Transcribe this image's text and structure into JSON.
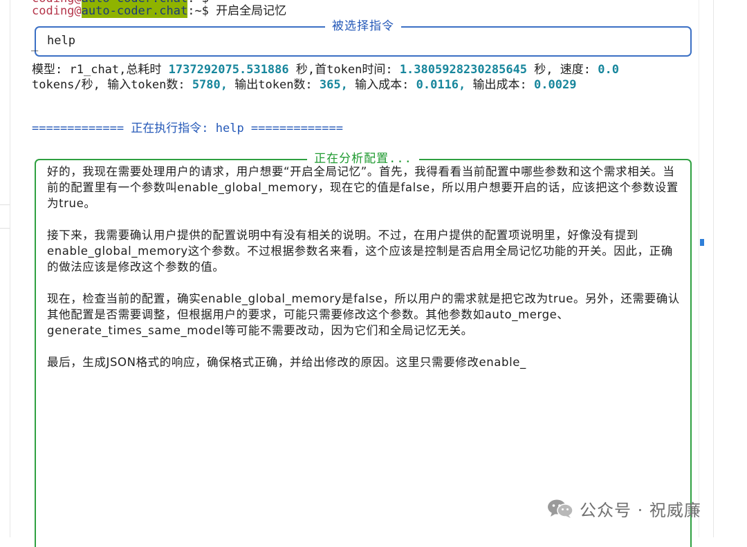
{
  "prompt": {
    "user": "coding",
    "at": "@",
    "host": "auto-coder.chat",
    "path": ":~$",
    "command": "开启全局记忆"
  },
  "command_panel": {
    "title": "被选择指令",
    "value": "help"
  },
  "stats": {
    "model_label": "模型:",
    "model_value": "r1_chat,",
    "total_time_label": "总耗时",
    "total_time_value": "1737292075.531886",
    "total_time_unit": "秒,",
    "first_token_label": "首token时间:",
    "first_token_value": "1.3805928230285645",
    "first_token_unit": "秒,",
    "speed_label": "速度:",
    "speed_value": "0.0",
    "speed_unit": "tokens/秒,",
    "input_tokens_label": "输入token数:",
    "input_tokens_value": "5780,",
    "output_tokens_label": "输出token数:",
    "output_tokens_value": "365,",
    "input_cost_label": "输入成本:",
    "input_cost_value": "0.0116,",
    "output_cost_label": "输出成本:",
    "output_cost_value": "0.0029"
  },
  "exec_banner": "============= 正在执行指令: help =============",
  "analysis_panel": {
    "title": "正在分析配置...",
    "paragraphs": [
      "好的，我现在需要处理用户的请求，用户想要“开启全局记忆”。首先，我得看看当前配置中哪些参数和这个需求相关。当前的配置里有一个参数叫enable_global_memory，现在它的值是false，所以用户想要开启的话，应该把这个参数设置为true。",
      "接下来，我需要确认用户提供的配置说明中有没有相关的说明。不过，在用户提供的配置项说明里，好像没有提到enable_global_memory这个参数。不过根据参数名来看，这个应该是控制是否启用全局记忆功能的开关。因此，正确的做法应该是修改这个参数的值。",
      "现在，检查当前的配置，确实enable_global_memory是false，所以用户的需求就是把它改为true。另外，还需要确认其他配置是否需要调整，但根据用户的要求，可能只需要修改这个参数。其他参数如auto_merge、generate_times_same_model等可能不需要改动，因为它们和全局记忆无关。",
      "最后，生成JSON格式的响应，确保格式正确，并给出修改的原因。这里只需要修改enable_"
    ]
  },
  "watermark": {
    "icon": "wechat-icon",
    "text": "公众号 · 祝威廉"
  }
}
